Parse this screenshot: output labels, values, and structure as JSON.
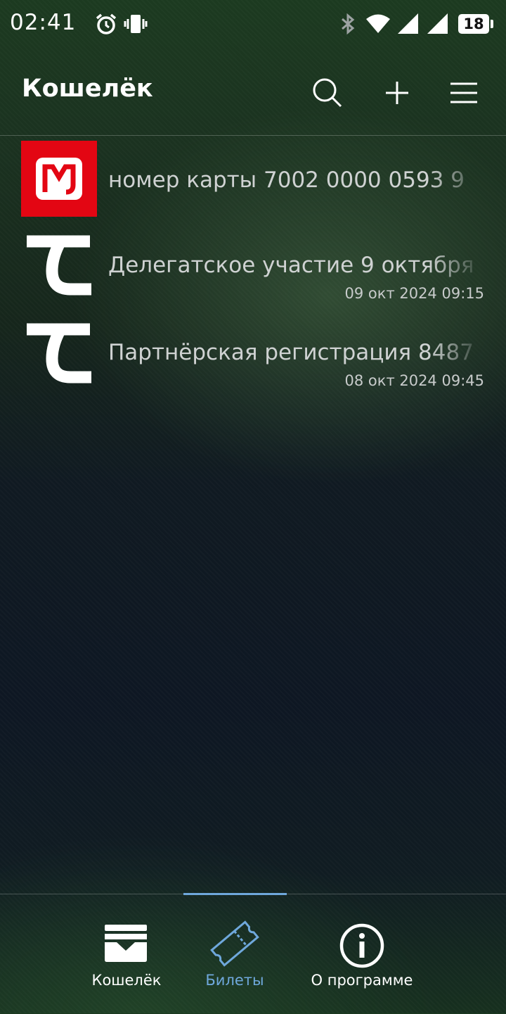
{
  "status_bar": {
    "time": "02:41",
    "battery": "18"
  },
  "app_bar": {
    "title": "Кошелёк"
  },
  "items": [
    {
      "logo": "red-m-icon",
      "title": "номер карты 7002 0000 0593 9",
      "date": ""
    },
    {
      "logo": "t-icon",
      "title": "Делегатское участие 9 октября",
      "date": "09 окт 2024 09:15"
    },
    {
      "logo": "t-icon",
      "title": "Партнёрская регистрация 8487",
      "date": "08 окт 2024 09:45"
    }
  ],
  "nav": {
    "active": "tickets",
    "tabs": [
      {
        "id": "wallet",
        "label": "Кошелёк",
        "icon": "wallet-icon"
      },
      {
        "id": "tickets",
        "label": "Билеты",
        "icon": "ticket-icon"
      },
      {
        "id": "about",
        "label": "О программе",
        "icon": "info-icon"
      }
    ]
  },
  "colors": {
    "accent": "#6fa8dc",
    "logo_red": "#e30613"
  }
}
